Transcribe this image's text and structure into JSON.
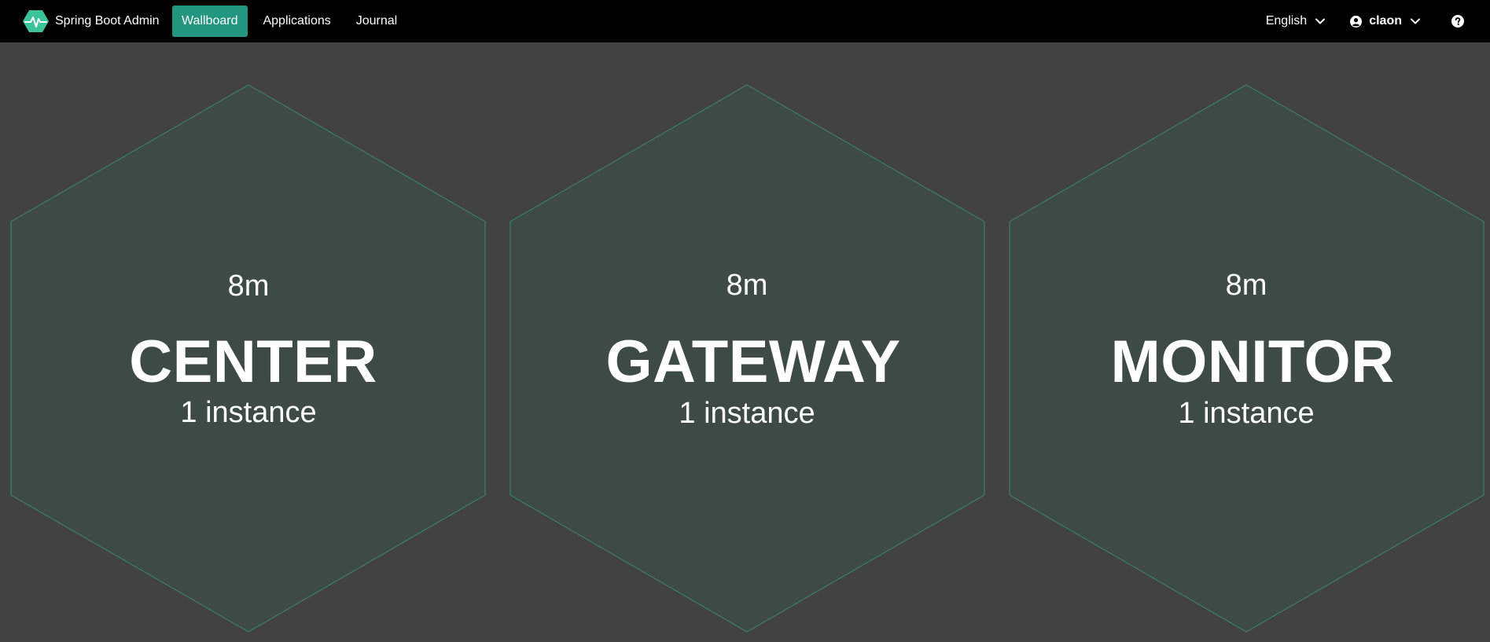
{
  "app": {
    "name": "Spring Boot Admin",
    "logo_icon": "spring-boot-admin-hexagon-pulse-icon",
    "accent_color": "#23967f"
  },
  "nav": {
    "links": [
      {
        "label": "Wallboard",
        "active": true
      },
      {
        "label": "Applications",
        "active": false
      },
      {
        "label": "Journal",
        "active": false
      }
    ]
  },
  "header_right": {
    "language": "English",
    "user": "claon",
    "help_icon": "question-circle-icon"
  },
  "wallboard": {
    "background_color": "#424242",
    "hexagon_fill": "#3e4a45",
    "hexagon_stroke": "#3d8a67",
    "applications": [
      {
        "name": "CENTER",
        "uptime": "8m",
        "instances": "1 instance",
        "status": "UP"
      },
      {
        "name": "GATEWAY",
        "uptime": "8m",
        "instances": "1 instance",
        "status": "UP"
      },
      {
        "name": "MONITOR",
        "uptime": "8m",
        "instances": "1 instance",
        "status": "UP"
      }
    ]
  }
}
